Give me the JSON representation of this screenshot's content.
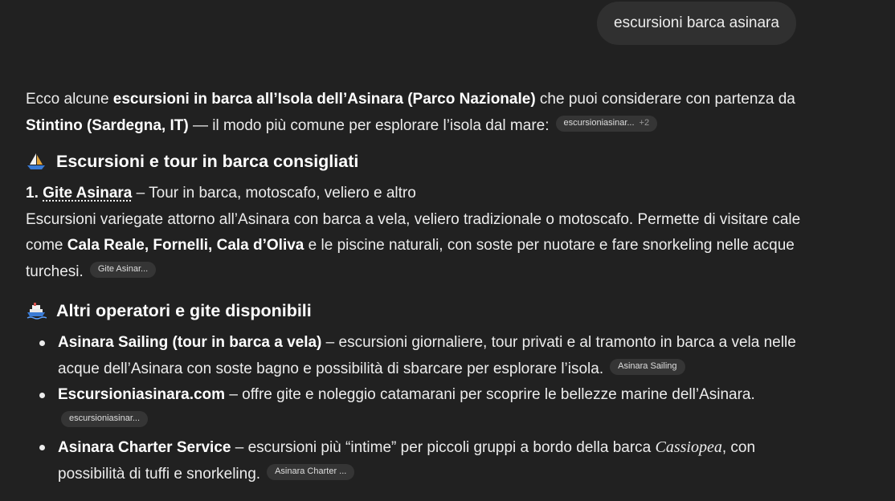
{
  "user_message": "escursioni barca asinara",
  "intro": {
    "t1": "Ecco alcune ",
    "b1": "escursioni in barca all’Isola dell’Asinara (Parco Nazionale)",
    "t2": " che puoi considerare con partenza da ",
    "b2": "Stintino (Sardegna, IT)",
    "t3": " — il modo più comune per esplorare l’isola dal mare:",
    "chip": "escursioniasinar...",
    "chip_more": "+2"
  },
  "section1": {
    "icon": "sailboat-icon",
    "heading": "Escursioni e tour in barca consigliati",
    "item": {
      "number": "1.",
      "title": "Gite Asinara",
      "subtitle": " – Tour in barca, motoscafo, veliero e altro",
      "d1": "Escursioni variegate attorno all’Asinara con barca a vela, veliero tradizionale o motoscafo. Permette di visitare cale come ",
      "db": "Cala Reale, Fornelli, Cala d’Oliva",
      "d2": " e le piscine naturali, con soste per nuotare e fare snorkeling nelle acque turchesi.",
      "chip": "Gite Asinar..."
    }
  },
  "section2": {
    "icon": "ship-icon",
    "heading": "Altri operatori e gite disponibili",
    "items": [
      {
        "title": "Asinara Sailing (tour in barca a vela)",
        "text": " – escursioni giornaliere, tour privati e al tramonto in barca a vela nelle acque dell’Asinara con soste bagno e possibilità di sbarcare per esplorare l’isola.",
        "chip": "Asinara Sailing"
      },
      {
        "title": "Escursioniasinara.com",
        "text": " – offre gite e noleggio catamarani per scoprire le bellezze marine dell’Asinara.",
        "chip": "escursioniasinar..."
      },
      {
        "title": "Asinara Charter Service",
        "text": " – escursioni più “intime” per piccoli gruppi a bordo della barca ",
        "italic": "Cassiopea",
        "text2": ", con possibilità di tuffi e snorkeling.",
        "chip": "Asinara Charter ..."
      }
    ]
  },
  "colors": {
    "background": "#212121",
    "bubble": "#303030",
    "chip": "#353535",
    "text": "#ececec"
  }
}
